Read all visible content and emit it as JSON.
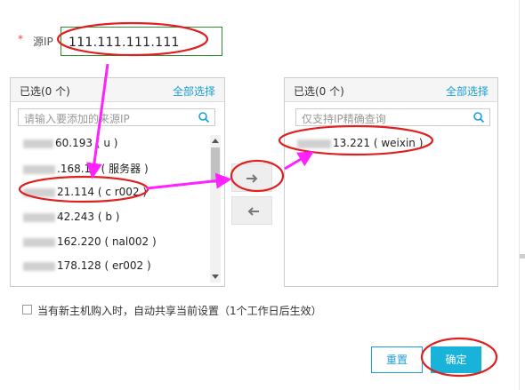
{
  "form": {
    "required_mark": "*",
    "source_ip_label": "源IP",
    "source_ip_value": "111.111.111.111"
  },
  "left_panel": {
    "title": "已选(0 个)",
    "select_all": "全部选择",
    "search_placeholder": "请输入要添加的来源IP",
    "items": [
      {
        "ip": "60.193",
        "name": "( u )"
      },
      {
        "ip": ".168.14",
        "name": "( 服务器 )"
      },
      {
        "ip": "21.114",
        "name": "( c r002 )"
      },
      {
        "ip": "42.243",
        "name": "( b )"
      },
      {
        "ip": "162.220",
        "name": "( nal002 )"
      },
      {
        "ip": "178.128",
        "name": "( er002 )"
      }
    ]
  },
  "right_panel": {
    "title": "已选(0 个)",
    "select_all": "全部选择",
    "search_placeholder": "仅支持IP精确查询",
    "items": [
      {
        "ip": "13.221",
        "name": "( weixin )"
      }
    ]
  },
  "transfer": {
    "add_icon": "arrow-right-icon",
    "remove_icon": "arrow-left-icon"
  },
  "options": {
    "auto_share_label": "当有新主机购入时，自动共享当前设置（1个工作日后生效）"
  },
  "footer": {
    "reset_label": "重置",
    "confirm_label": "确定"
  },
  "colors": {
    "accent": "#1aa0d8",
    "confirm_bg": "#19b3d9",
    "annotation_red": "#e02020",
    "annotation_magenta": "#ff22ff",
    "input_border": "#2e8b2e"
  }
}
